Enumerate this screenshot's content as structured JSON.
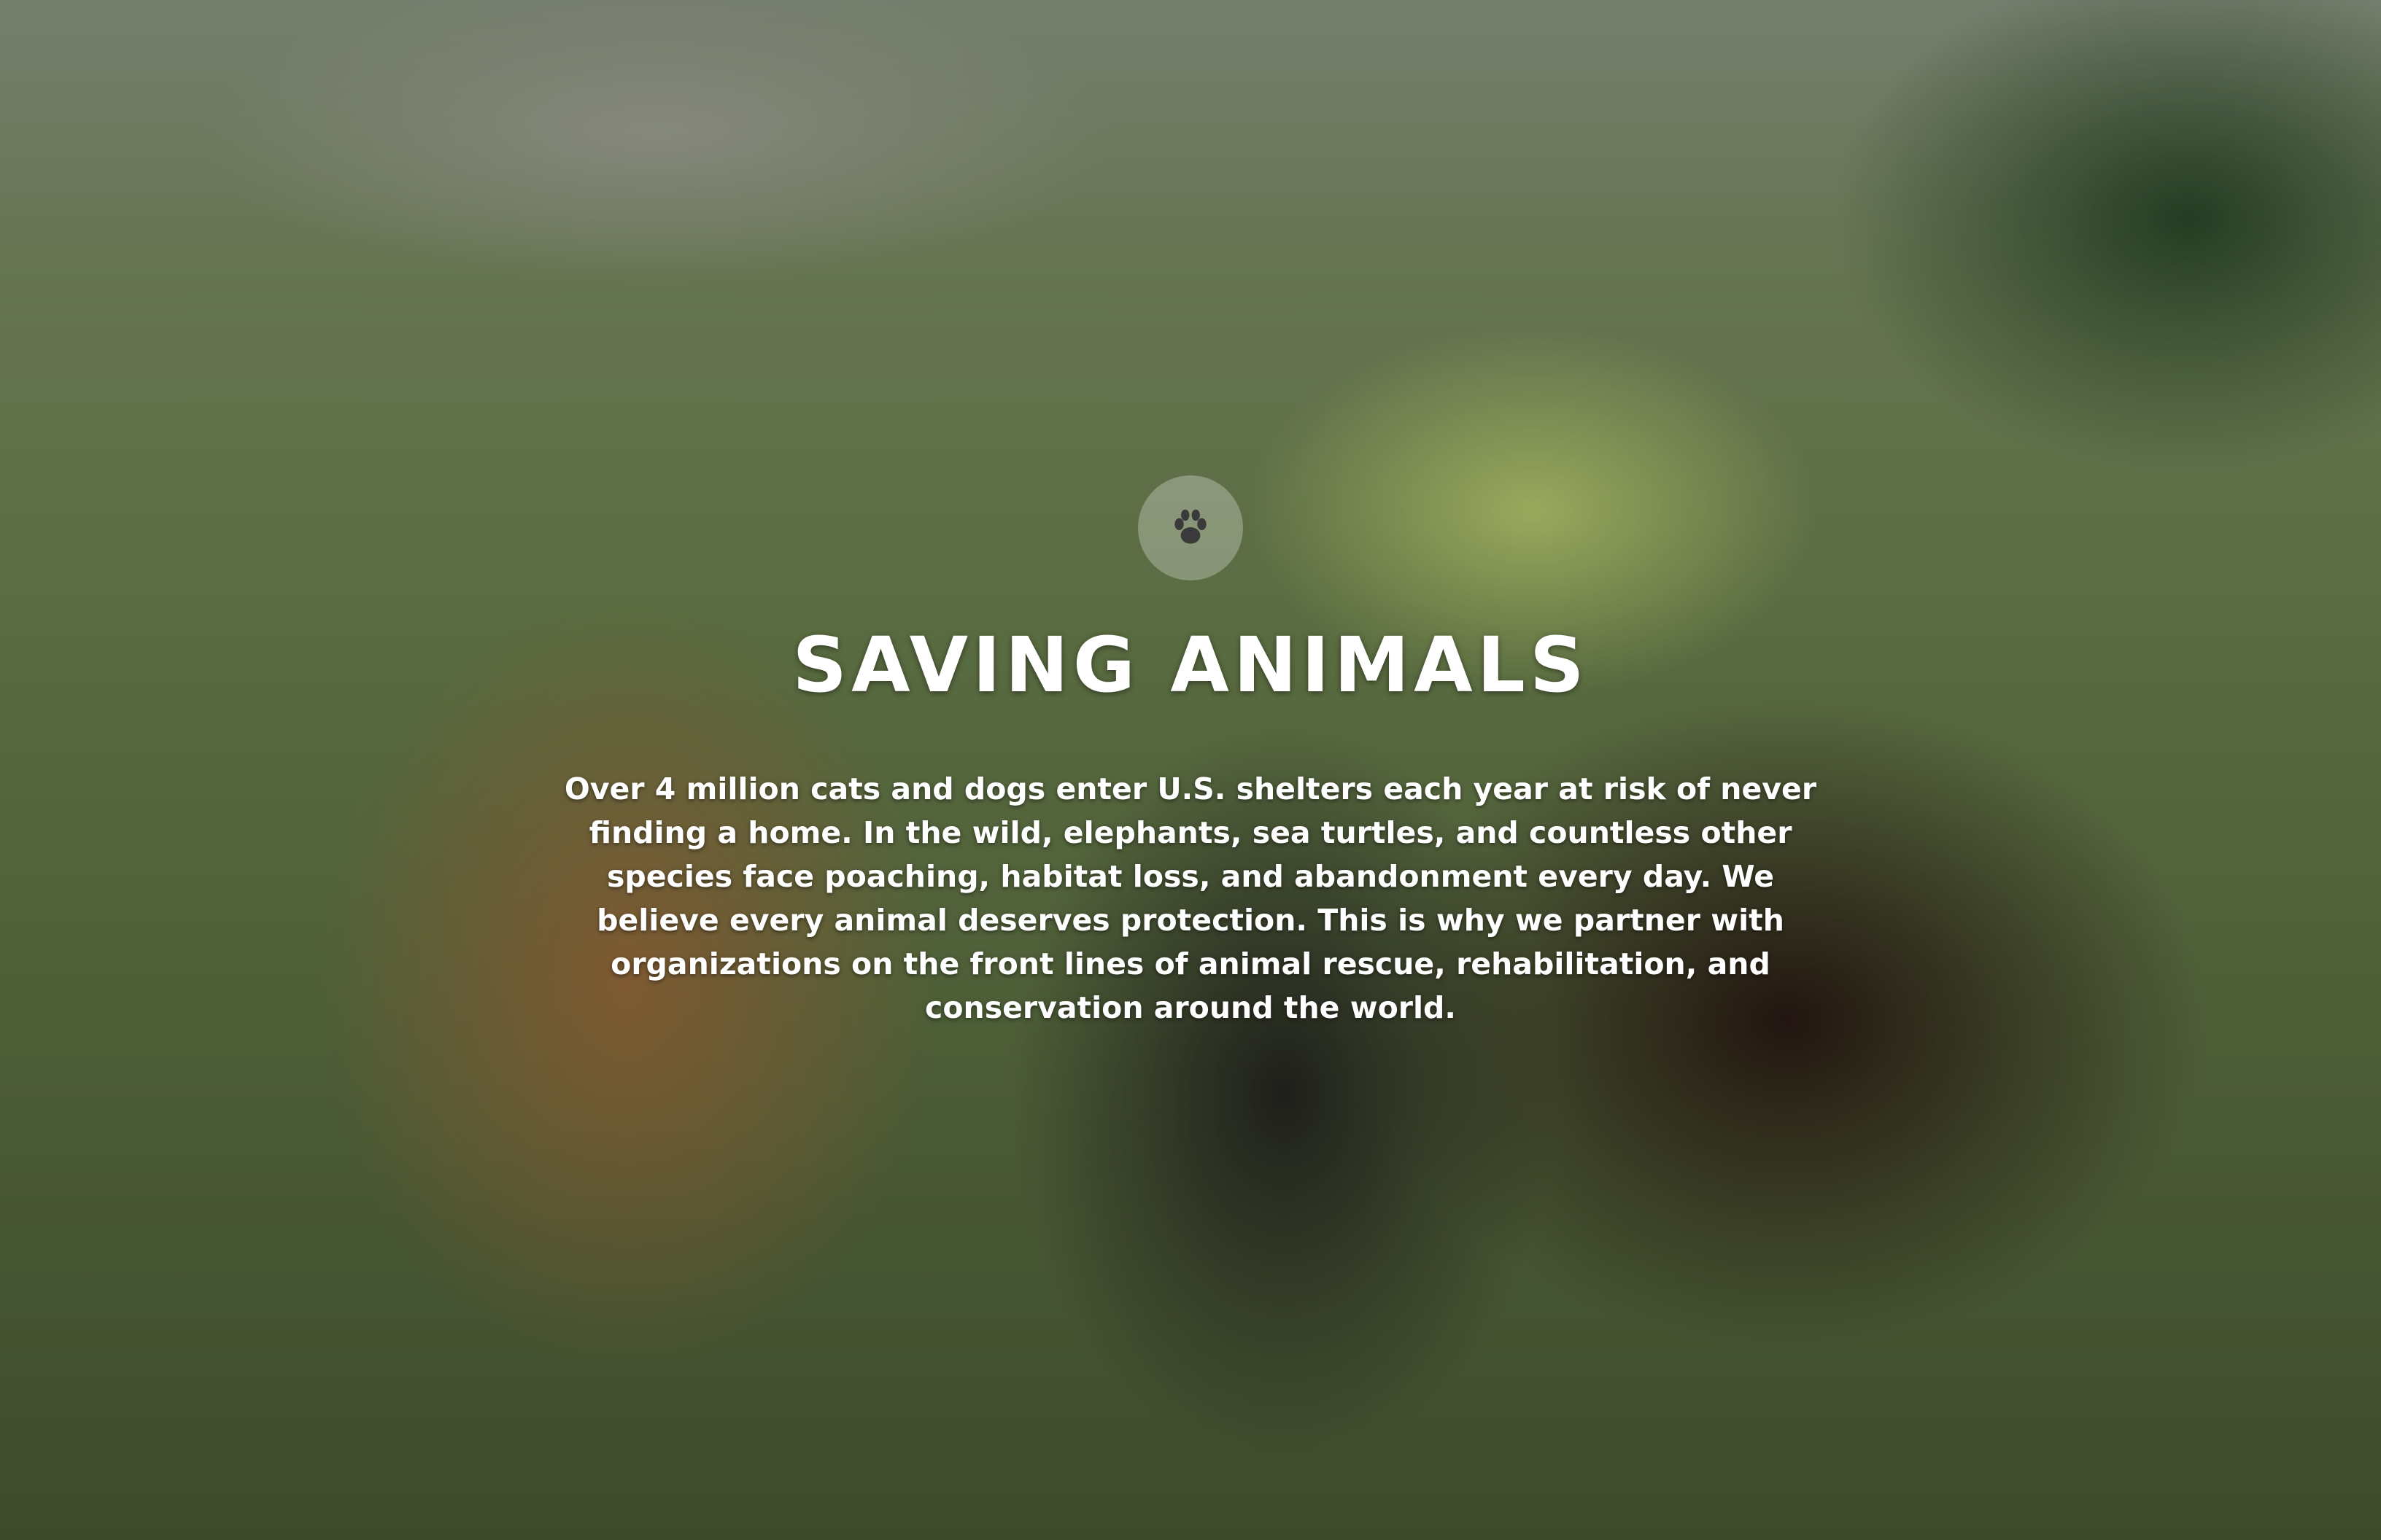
{
  "hero": {
    "title": "SAVING ANIMALS",
    "body": "Over 4 million cats and dogs enter U.S. shelters each year at risk of never finding a home. In the wild, elephants, sea turtles, and countless other species face poaching, habitat loss, and abandonment every day. We believe every animal deserves protection. This is why we partner with organizations on the front lines of animal rescue, rehabilitation, and conservation around the world.",
    "icon": "paw-icon",
    "text_color": "#ffffff",
    "badge_color": "rgba(255,255,255,0.28)"
  }
}
